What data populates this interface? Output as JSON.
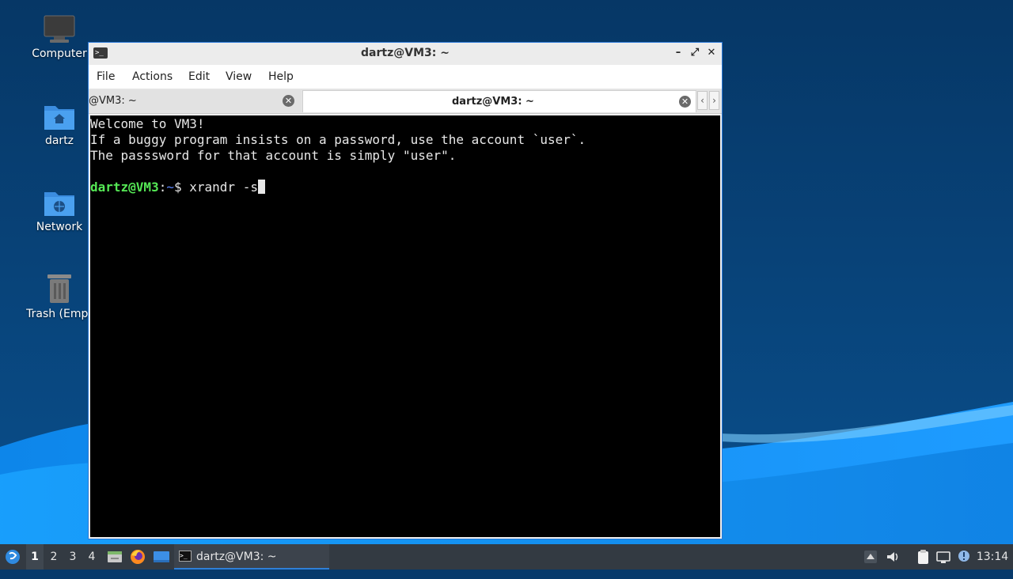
{
  "desktop": {
    "icons": [
      {
        "label": "Computer",
        "icon": "computer-icon"
      },
      {
        "label": "dartz",
        "icon": "home-folder-icon"
      },
      {
        "label": "Network",
        "icon": "network-folder-icon"
      },
      {
        "label": "Trash (Empt",
        "icon": "trash-icon"
      }
    ]
  },
  "window": {
    "title": "dartz@VM3: ~",
    "buttons": {
      "minimize": "–",
      "maximize": "⤢",
      "close": "✕"
    },
    "menu": [
      "File",
      "Actions",
      "Edit",
      "View",
      "Help"
    ],
    "tabs": [
      {
        "label": "@VM3: ~",
        "active": false
      },
      {
        "label": "dartz@VM3: ~",
        "active": true
      }
    ],
    "tab_close": "✕",
    "scroll_left": "‹",
    "scroll_right": "›"
  },
  "terminal": {
    "lines": [
      "Welcome to VM3!",
      "If a buggy program insists on a password, use the account `user`.",
      "The passsword for that account is simply \"user\"."
    ],
    "prompt": {
      "user_host": "dartz@VM3",
      "sep": ":",
      "path": "~",
      "symbol": "$",
      "command": " xrandr -s"
    }
  },
  "taskbar": {
    "workspaces": [
      "1",
      "2",
      "3",
      "4"
    ],
    "active_workspace": "1",
    "launchers": [
      "file-manager-icon",
      "firefox-icon",
      "show-desktop-icon"
    ],
    "task_label": "dartz@VM3: ~",
    "tray": [
      "hidden-icons-arrow-icon",
      "volume-icon",
      "clipboard-icon",
      "network-status-icon",
      "notification-icon"
    ],
    "clock": "13:14"
  },
  "colors": {
    "desktop_bg": "#073a6b",
    "accent_blue": "#2a79d8",
    "prompt_user": "#55e855",
    "prompt_path": "#5b86ff",
    "taskbar_bg": "#333a42"
  }
}
